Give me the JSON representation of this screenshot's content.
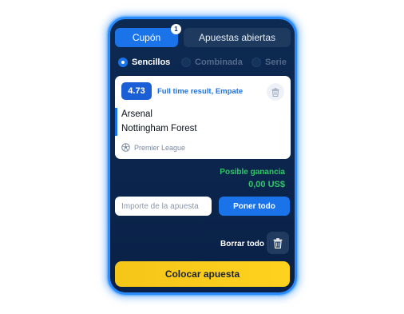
{
  "tabs": {
    "coupon": "Cupón",
    "coupon_badge": "1",
    "open_bets": "Apuestas abiertas"
  },
  "bet_types": [
    {
      "label": "Sencillos",
      "selected": true
    },
    {
      "label": "Combinada",
      "selected": false
    },
    {
      "label": "Serie",
      "selected": false
    }
  ],
  "bet": {
    "odds": "4.73",
    "market": "Full time result, Empate",
    "team_home": "Arsenal",
    "team_away": "Nottingham Forest",
    "league": "Premier League"
  },
  "winnings": {
    "label": "Posible ganancia",
    "value": "0,00 US$"
  },
  "stake": {
    "placeholder": "Importe de la apuesta",
    "all_button": "Poner todo"
  },
  "clear": {
    "label": "Borrar todo"
  },
  "place_bet": "Colocar apuesta",
  "colors": {
    "primary": "#1a73e8",
    "panel": "#0d2a52",
    "win": "#2ec866",
    "cta": "#ffd21f"
  }
}
